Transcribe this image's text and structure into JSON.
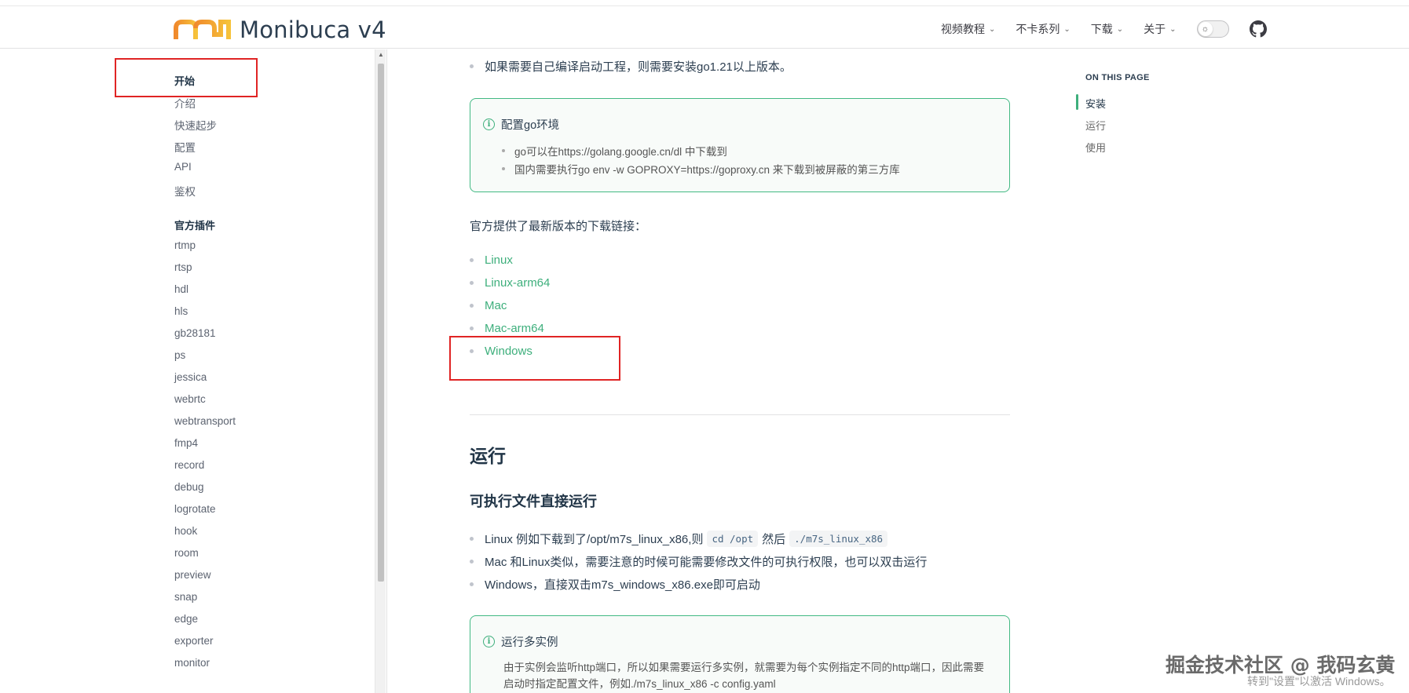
{
  "header": {
    "logo_text": "Monibuca v4",
    "nav": [
      {
        "label": "视频教程"
      },
      {
        "label": "不卡系列"
      },
      {
        "label": "下载"
      },
      {
        "label": "关于"
      }
    ]
  },
  "sidebar": {
    "group1_title": "开始",
    "group1_items": [
      "介绍",
      "快速起步",
      "配置",
      "API",
      "鉴权"
    ],
    "group2_title": "官方插件",
    "group2_items": [
      "rtmp",
      "rtsp",
      "hdl",
      "hls",
      "gb28181",
      "ps",
      "jessica",
      "webrtc",
      "webtransport",
      "fmp4",
      "record",
      "debug",
      "logrotate",
      "hook",
      "room",
      "preview",
      "snap",
      "edge",
      "exporter",
      "monitor"
    ]
  },
  "content": {
    "top_bullet": "如果需要自己编译启动工程，则需要安装go1.21以上版本。",
    "tip1": {
      "title": "配置go环境",
      "items": [
        "go可以在https://golang.google.cn/dl 中下载到",
        "国内需要执行go env -w GOPROXY=https://goproxy.cn 来下载到被屏蔽的第三方库"
      ]
    },
    "download_intro": "官方提供了最新版本的下载链接：",
    "downloads": [
      "Linux",
      "Linux-arm64",
      "Mac",
      "Mac-arm64",
      "Windows"
    ],
    "run_heading": "运行",
    "run_sub_heading": "可执行文件直接运行",
    "run_bullets": {
      "b1_prefix": "Linux 例如下载到了/opt/m7s_linux_x86,则",
      "b1_code1": "cd /opt",
      "b1_mid": "然后",
      "b1_code2": "./m7s_linux_x86",
      "b2": "Mac 和Linux类似，需要注意的时候可能需要修改文件的可执行权限，也可以双击运行",
      "b3": "Windows，直接双击m7s_windows_x86.exe即可启动"
    },
    "tip2": {
      "title": "运行多实例",
      "text": "由于实例会监听http端口，所以如果需要运行多实例，就需要为每个实例指定不同的http端口，因此需要启动时指定配置文件，例如./m7s_linux_x86 -c config.yaml"
    }
  },
  "on_this_page": {
    "title": "ON THIS PAGE",
    "items": [
      "安装",
      "运行",
      "使用"
    ]
  },
  "overlay": {
    "watermark": "掘金技术社区 @ 我码玄黄",
    "activate_text": "转到\"设置\"以激活 Windows。"
  },
  "colors": {
    "accent": "#3eaf7c",
    "annotation_red": "#e02424"
  }
}
